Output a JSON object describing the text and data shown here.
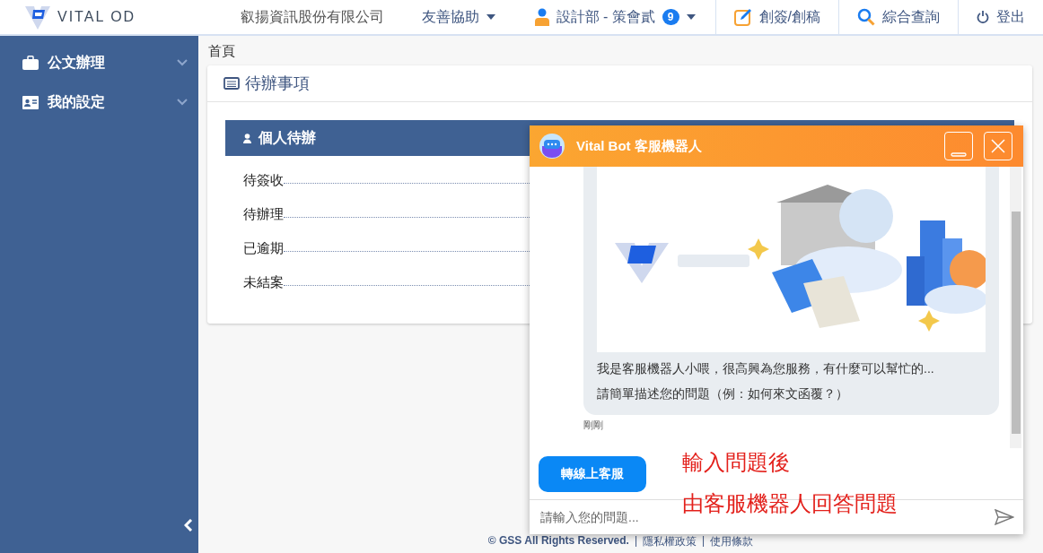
{
  "header": {
    "logo_text": "VITAL OD",
    "nav": [
      {
        "kind": "company",
        "label": "叡揚資訊股份有限公司"
      },
      {
        "kind": "dropdown",
        "label": "友善協助"
      },
      {
        "kind": "user",
        "label": "設計部 - 策會貳",
        "badge": "9"
      },
      {
        "kind": "compose",
        "label": "創簽/創稿"
      },
      {
        "kind": "search",
        "label": "綜合查詢"
      },
      {
        "kind": "logout",
        "label": "登出"
      }
    ]
  },
  "sidebar": {
    "items": [
      {
        "kind": "briefcase",
        "label": "公文辦理"
      },
      {
        "kind": "card",
        "label": "我的設定"
      }
    ]
  },
  "breadcrumb": "首頁",
  "panel": {
    "title": "待辦事項",
    "section": "個人待辦",
    "items": [
      "待簽收",
      "待辦理",
      "已逾期",
      "未結案"
    ]
  },
  "chat": {
    "title": "Vital Bot 客服機器人",
    "message": {
      "lines": [
        "我是客服機器人小喂，很高興為您服務，有什麼可以幫忙的...",
        "請簡單描述您的問題（例：如何來文函覆？）"
      ],
      "time": "剛剛"
    },
    "transfer_button": "轉線上客服",
    "input": {
      "placeholder": "請輸入您的問題..."
    }
  },
  "annotations": [
    "輸入問題後",
    "由客服機器人回答問題"
  ],
  "footer": {
    "parts": [
      {
        "kind": "text",
        "label": "© GSS All Rights Reserved."
      },
      {
        "kind": "separator",
        "label": "|"
      },
      {
        "kind": "link",
        "label": "隱私權政策"
      },
      {
        "kind": "separator",
        "label": "|"
      },
      {
        "kind": "link",
        "label": "使用條款"
      }
    ]
  }
}
